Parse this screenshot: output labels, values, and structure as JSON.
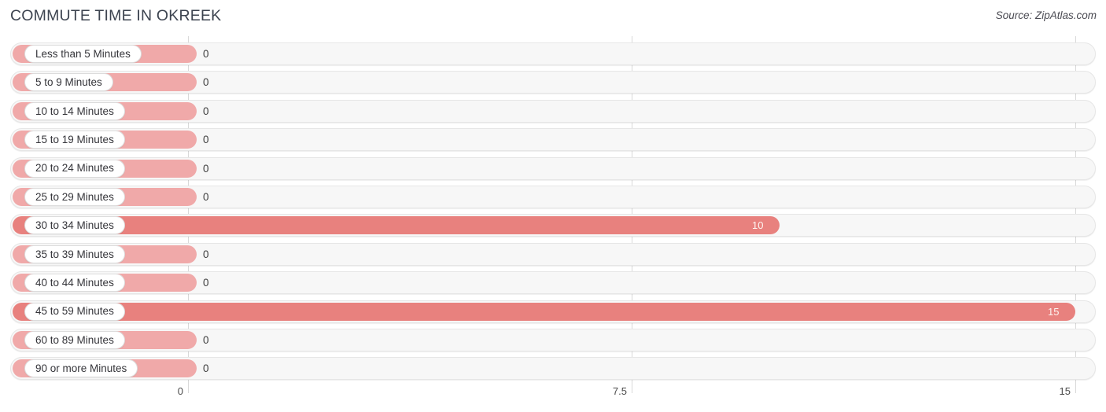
{
  "header": {
    "title": "COMMUTE TIME IN OKREEK",
    "source": "Source: ZipAtlas.com"
  },
  "colors": {
    "bar_light": "#f0a9a9",
    "bar_strong": "#e8817e",
    "track": "#f7f7f7",
    "track_border": "#e6e6e6",
    "gridline": "#d8d8d8",
    "title_text": "#3d4450",
    "value_text": "#3a3a3a",
    "value_text_inside": "#fdf3ef"
  },
  "axis": {
    "ticks": [
      "0",
      "7.5",
      "15"
    ],
    "tick_values": [
      0,
      7.5,
      15
    ]
  },
  "chart_data": {
    "type": "bar",
    "orientation": "horizontal",
    "title": "COMMUTE TIME IN OKREEK",
    "subtitle": "Source: ZipAtlas.com",
    "xlabel": "",
    "ylabel": "",
    "xlim": [
      0,
      15
    ],
    "xticks": [
      0,
      7.5,
      15
    ],
    "xticklabels": [
      "0",
      "7.5",
      "15"
    ],
    "grid": true,
    "legend": "none",
    "categories": [
      "Less than 5 Minutes",
      "5 to 9 Minutes",
      "10 to 14 Minutes",
      "15 to 19 Minutes",
      "20 to 24 Minutes",
      "25 to 29 Minutes",
      "30 to 34 Minutes",
      "35 to 39 Minutes",
      "40 to 44 Minutes",
      "45 to 59 Minutes",
      "60 to 89 Minutes",
      "90 or more Minutes"
    ],
    "values": [
      0,
      0,
      0,
      0,
      0,
      0,
      10,
      0,
      0,
      15,
      0,
      0
    ],
    "value_labels": [
      "0",
      "0",
      "0",
      "0",
      "0",
      "0",
      "10",
      "0",
      "0",
      "15",
      "0",
      "0"
    ]
  },
  "rows": [
    {
      "label": "Less than 5 Minutes",
      "value": 0,
      "value_label": "0"
    },
    {
      "label": "5 to 9 Minutes",
      "value": 0,
      "value_label": "0"
    },
    {
      "label": "10 to 14 Minutes",
      "value": 0,
      "value_label": "0"
    },
    {
      "label": "15 to 19 Minutes",
      "value": 0,
      "value_label": "0"
    },
    {
      "label": "20 to 24 Minutes",
      "value": 0,
      "value_label": "0"
    },
    {
      "label": "25 to 29 Minutes",
      "value": 0,
      "value_label": "0"
    },
    {
      "label": "30 to 34 Minutes",
      "value": 10,
      "value_label": "10"
    },
    {
      "label": "35 to 39 Minutes",
      "value": 0,
      "value_label": "0"
    },
    {
      "label": "40 to 44 Minutes",
      "value": 0,
      "value_label": "0"
    },
    {
      "label": "45 to 59 Minutes",
      "value": 15,
      "value_label": "15"
    },
    {
      "label": "60 to 89 Minutes",
      "value": 0,
      "value_label": "0"
    },
    {
      "label": "90 or more Minutes",
      "value": 0,
      "value_label": "0"
    }
  ]
}
